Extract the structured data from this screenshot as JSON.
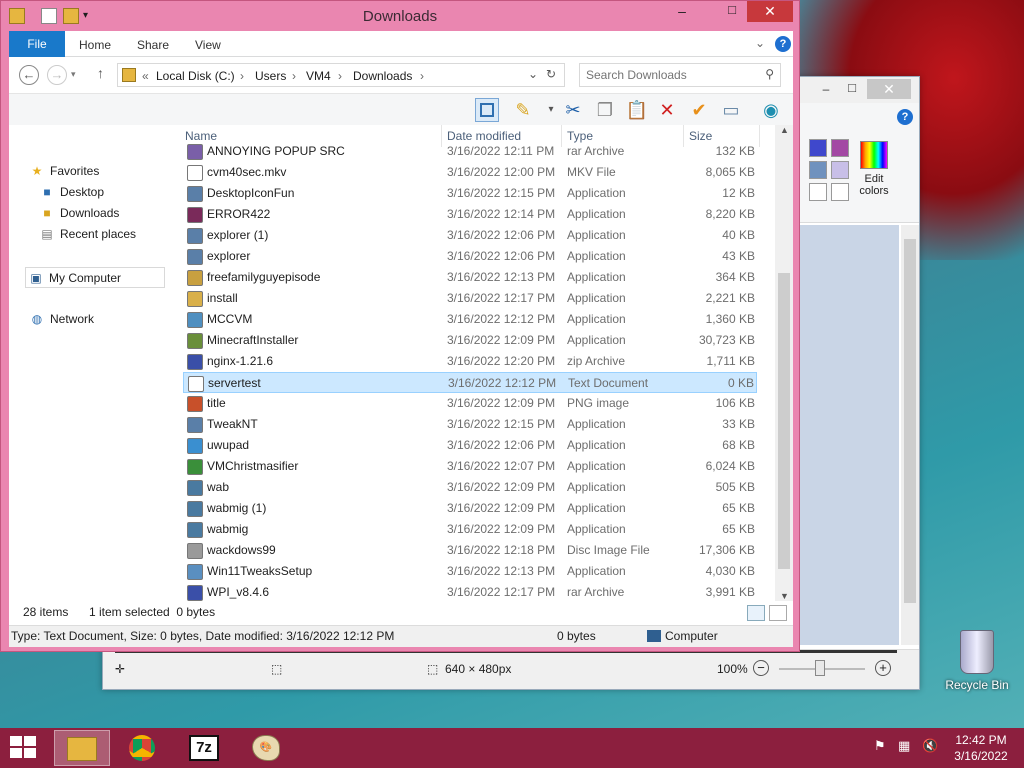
{
  "explorer": {
    "title": "Downloads",
    "ribbon_tabs": [
      "File",
      "Home",
      "Share",
      "View"
    ],
    "breadcrumb": [
      "Local Disk (C:)",
      "Users",
      "VM4",
      "Downloads"
    ],
    "breadcrumb_prefix": "«",
    "search_placeholder": "Search Downloads",
    "nav": {
      "favorites": "Favorites",
      "desktop": "Desktop",
      "downloads": "Downloads",
      "recent": "Recent places",
      "computer": "My Computer",
      "network": "Network"
    },
    "columns": {
      "name": "Name",
      "date": "Date modified",
      "type": "Type",
      "size": "Size"
    },
    "files": [
      {
        "name": "ANNOYING POPUP SRC",
        "date": "3/16/2022 12:11 PM",
        "type": "rar Archive",
        "size": "132 KB",
        "icon": "archive-icon",
        "color": "#7a5fa8"
      },
      {
        "name": "cvm40sec.mkv",
        "date": "3/16/2022 12:00 PM",
        "type": "MKV File",
        "size": "8,065 KB",
        "icon": "file-icon",
        "color": "#ffffff"
      },
      {
        "name": "DesktopIconFun",
        "date": "3/16/2022 12:15 PM",
        "type": "Application",
        "size": "12 KB",
        "icon": "app-icon",
        "color": "#5a7fa8"
      },
      {
        "name": "ERROR422",
        "date": "3/16/2022 12:14 PM",
        "type": "Application",
        "size": "8,220 KB",
        "icon": "error-app-icon",
        "color": "#7a2a5a"
      },
      {
        "name": "explorer (1)",
        "date": "3/16/2022 12:06 PM",
        "type": "Application",
        "size": "40 KB",
        "icon": "app-icon",
        "color": "#5a7fa8"
      },
      {
        "name": "explorer",
        "date": "3/16/2022 12:06 PM",
        "type": "Application",
        "size": "43 KB",
        "icon": "app-icon",
        "color": "#5a7fa8"
      },
      {
        "name": "freefamilyguyepisode",
        "date": "3/16/2022 12:13 PM",
        "type": "Application",
        "size": "364 KB",
        "icon": "installer-icon",
        "color": "#c8a040"
      },
      {
        "name": "install",
        "date": "3/16/2022 12:17 PM",
        "type": "Application",
        "size": "2,221 KB",
        "icon": "installer-icon",
        "color": "#d9b04a"
      },
      {
        "name": "MCCVM",
        "date": "3/16/2022 12:12 PM",
        "type": "Application",
        "size": "1,360 KB",
        "icon": "app-icon",
        "color": "#4f8fc0"
      },
      {
        "name": "MinecraftInstaller",
        "date": "3/16/2022 12:09 PM",
        "type": "Application",
        "size": "30,723 KB",
        "icon": "minecraft-icon",
        "color": "#6a8f3a"
      },
      {
        "name": "nginx-1.21.6",
        "date": "3/16/2022 12:20 PM",
        "type": "zip Archive",
        "size": "1,711 KB",
        "icon": "zip-icon",
        "color": "#3a4fa8"
      },
      {
        "name": "servertest",
        "date": "3/16/2022 12:12 PM",
        "type": "Text Document",
        "size": "0 KB",
        "icon": "text-file-icon",
        "color": "#ffffff"
      },
      {
        "name": "title",
        "date": "3/16/2022 12:09 PM",
        "type": "PNG image",
        "size": "106 KB",
        "icon": "image-icon",
        "color": "#c8502a"
      },
      {
        "name": "TweakNT",
        "date": "3/16/2022 12:15 PM",
        "type": "Application",
        "size": "33 KB",
        "icon": "app-icon",
        "color": "#5a7fa8"
      },
      {
        "name": "uwupad",
        "date": "3/16/2022 12:06 PM",
        "type": "Application",
        "size": "68 KB",
        "icon": "app-icon",
        "color": "#3a8fd0"
      },
      {
        "name": "VMChristmasifier",
        "date": "3/16/2022 12:07 PM",
        "type": "Application",
        "size": "6,024 KB",
        "icon": "tree-icon",
        "color": "#3a8f3a"
      },
      {
        "name": "wab",
        "date": "3/16/2022 12:09 PM",
        "type": "Application",
        "size": "505 KB",
        "icon": "app-icon",
        "color": "#4a7aa0"
      },
      {
        "name": "wabmig (1)",
        "date": "3/16/2022 12:09 PM",
        "type": "Application",
        "size": "65 KB",
        "icon": "app-icon",
        "color": "#4a7aa0"
      },
      {
        "name": "wabmig",
        "date": "3/16/2022 12:09 PM",
        "type": "Application",
        "size": "65 KB",
        "icon": "app-icon",
        "color": "#4a7aa0"
      },
      {
        "name": "wackdows99",
        "date": "3/16/2022 12:18 PM",
        "type": "Disc Image File",
        "size": "17,306 KB",
        "icon": "disc-icon",
        "color": "#9a9a9a"
      },
      {
        "name": "Win11TweaksSetup",
        "date": "3/16/2022 12:13 PM",
        "type": "Application",
        "size": "4,030 KB",
        "icon": "setup-icon",
        "color": "#5a8fc0"
      },
      {
        "name": "WPI_v8.4.6",
        "date": "3/16/2022 12:17 PM",
        "type": "rar Archive",
        "size": "3,991 KB",
        "icon": "archive-icon",
        "color": "#3a4fa8"
      }
    ],
    "selected_index": 11,
    "status": {
      "items": "28 items",
      "selected": "1 item selected  0 bytes"
    },
    "details": {
      "text": "Type: Text Document, Size: 0 bytes, Date modified: 3/16/2022 12:12 PM",
      "size": "0 bytes",
      "location": "Computer"
    }
  },
  "paint": {
    "edit_colors": [
      "Edit",
      "colors"
    ],
    "dimensions": "640 × 480px",
    "zoom": "100%"
  },
  "desktop": {
    "recycle_bin": "Recycle Bin"
  },
  "taskbar": {
    "time": "12:42 PM",
    "date": "3/16/2022"
  },
  "colors": {
    "accent": "#1979ca",
    "titlebar": "#ea86b0",
    "taskbar": "#8c1f3e",
    "selection": "#cce8ff"
  }
}
